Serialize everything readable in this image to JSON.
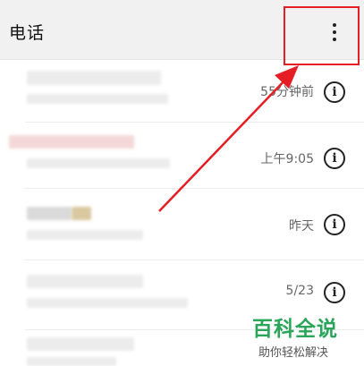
{
  "header": {
    "title": "电话",
    "menu_icon": "more-vert-icon"
  },
  "calls": [
    {
      "time": "55分钟前",
      "info_icon": "info-icon"
    },
    {
      "time": "上午9:05",
      "info_icon": "info-icon"
    },
    {
      "time": "昨天",
      "info_icon": "info-icon"
    },
    {
      "time": "5/23",
      "info_icon": "info-icon"
    }
  ],
  "annotation": {
    "color": "#e41e24"
  },
  "watermark": {
    "brand": "百科全说",
    "slogan": "助你轻松解决"
  }
}
